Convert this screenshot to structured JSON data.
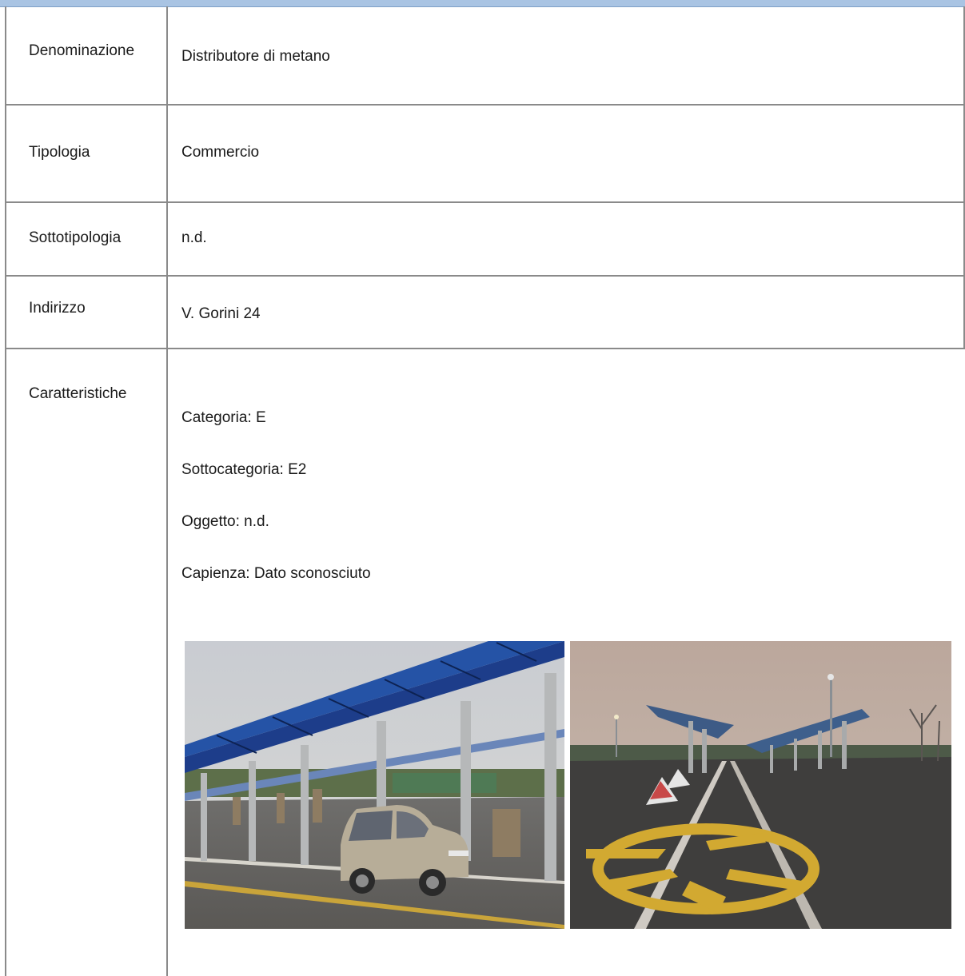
{
  "rows": [
    {
      "label": "Denominazione",
      "value": "Distributore di metano"
    },
    {
      "label": "Tipologia",
      "value": "Commercio"
    },
    {
      "label": "Sottotipologia",
      "value": "n.d."
    },
    {
      "label": "Indirizzo",
      "value": "V. Gorini 24"
    }
  ],
  "caratteristiche": {
    "label": "Caratteristiche",
    "lines": [
      "Categoria: E",
      "Sottocategoria: E2",
      "Oggetto: n.d.",
      "Capienza: Dato sconosciuto"
    ]
  },
  "photos": [
    {
      "name": "photo-canopy-with-car"
    },
    {
      "name": "photo-empty-forecourt"
    }
  ],
  "colors": {
    "header_band": "#a9c4e3",
    "grid_lines": "#8a8a8a"
  }
}
